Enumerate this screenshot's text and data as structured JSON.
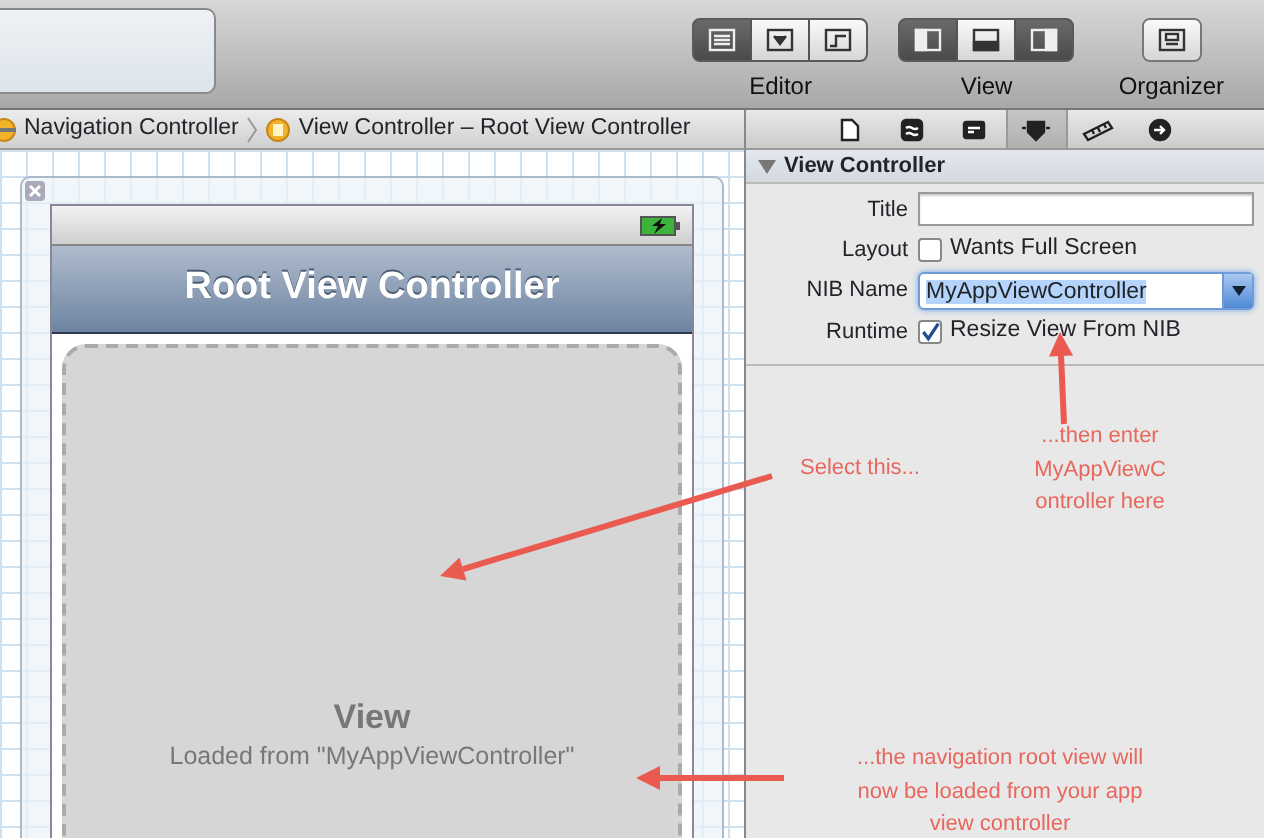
{
  "toolbar": {
    "groups": [
      {
        "label": "Editor",
        "buttons": [
          {
            "kind": "lines",
            "selected": true
          },
          {
            "kind": "assistant",
            "selected": false
          },
          {
            "kind": "version",
            "selected": false
          }
        ]
      },
      {
        "label": "View",
        "buttons": [
          {
            "kind": "left-pane",
            "selected": true
          },
          {
            "kind": "bottom-pane",
            "selected": false
          },
          {
            "kind": "right-pane",
            "selected": true
          }
        ]
      },
      {
        "label": "Organizer",
        "buttons": [
          {
            "kind": "organizer",
            "selected": false
          }
        ]
      }
    ]
  },
  "breadcrumb": [
    {
      "label": "Navigation Controller"
    },
    {
      "label": "View Controller – Root View Controller"
    }
  ],
  "inspector_tabs": [
    {
      "kind": "file",
      "selected": false
    },
    {
      "kind": "help",
      "selected": false
    },
    {
      "kind": "identity",
      "selected": false
    },
    {
      "kind": "attributes",
      "selected": true
    },
    {
      "kind": "size",
      "selected": false
    },
    {
      "kind": "connections",
      "selected": false
    }
  ],
  "inspector": {
    "section": "View Controller",
    "expanded": true,
    "fields": [
      {
        "label": "Title",
        "kind": "text"
      },
      {
        "label": "Layout",
        "kind": "checkbox",
        "checked": false,
        "text": "Wants Full Screen"
      },
      {
        "label": "NIB Name",
        "kind": "combo",
        "value": "MyAppViewController",
        "selected": true
      },
      {
        "label": "Runtime",
        "kind": "checkbox",
        "checked": true,
        "text": "Resize View From NIB"
      }
    ]
  },
  "scene": {
    "navigation_title": "Root View Controller",
    "view": {
      "title": "View",
      "subtitle": "Loaded from \"MyAppViewController\""
    }
  },
  "annotations": [
    {
      "lines": [
        "Select this..."
      ]
    },
    {
      "lines": [
        "...then enter",
        "MyAppViewC",
        "ontroller here"
      ]
    },
    {
      "lines": [
        "...the navigation root view will",
        "now be loaded from your app",
        "view controller"
      ]
    }
  ]
}
